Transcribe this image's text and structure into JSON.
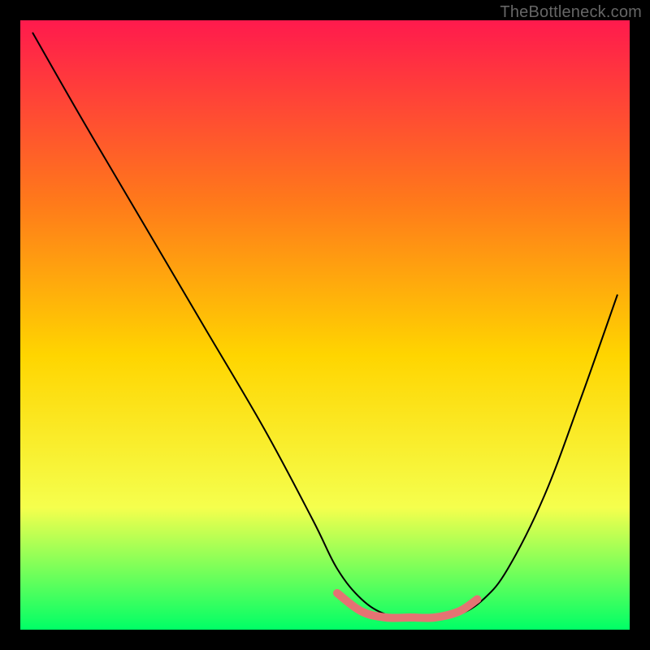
{
  "watermark": "TheBottleneck.com",
  "chart_data": {
    "type": "line",
    "title": "",
    "xlabel": "",
    "ylabel": "",
    "xlim": [
      0,
      100
    ],
    "ylim": [
      0,
      100
    ],
    "grid": false,
    "background_gradient": {
      "top": "#ff1a4d",
      "upper_mid": "#ff7a1a",
      "mid": "#ffd500",
      "lower_mid": "#f5ff4d",
      "bottom": "#00ff66"
    },
    "series": [
      {
        "name": "bottleneck-curve",
        "color": "#000000",
        "stroke_width": 2,
        "x": [
          2,
          10,
          20,
          30,
          40,
          48,
          52,
          56,
          60,
          64,
          68,
          72,
          76,
          80,
          86,
          92,
          98
        ],
        "y": [
          98,
          84,
          67,
          50,
          33,
          18,
          10,
          5,
          2.5,
          2,
          2,
          2.5,
          5,
          10,
          22,
          38,
          55
        ]
      },
      {
        "name": "sweet-spot-marker",
        "color": "#e57373",
        "stroke_width": 10,
        "x": [
          52,
          56,
          60,
          64,
          68,
          72,
          75
        ],
        "y": [
          6,
          3,
          2,
          2,
          2,
          3,
          5
        ]
      }
    ],
    "annotations": []
  }
}
